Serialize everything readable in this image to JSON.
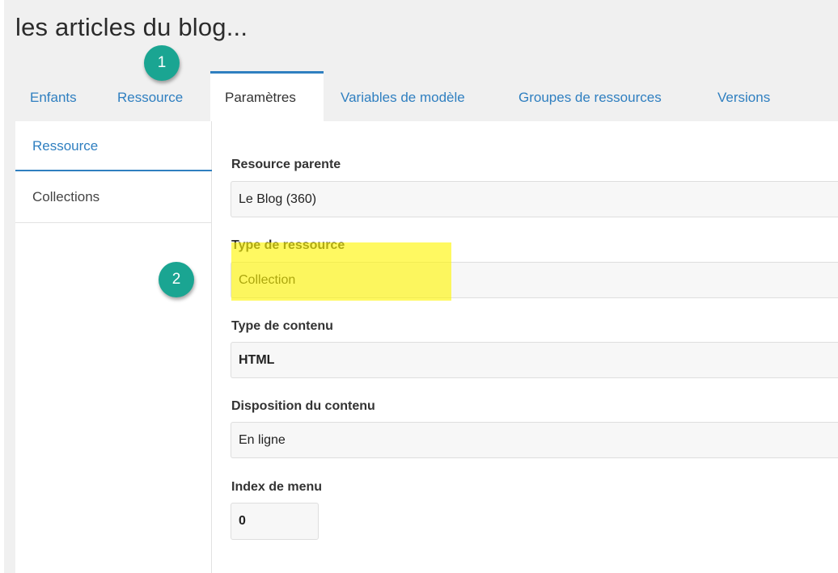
{
  "header": {
    "title": "les articles du blog..."
  },
  "tabs": [
    {
      "label": "Enfants",
      "active": false
    },
    {
      "label": "Ressource",
      "active": false
    },
    {
      "label": "Paramètres",
      "active": true
    },
    {
      "label": "Variables de modèle",
      "active": false
    },
    {
      "label": "Groupes de ressources",
      "active": false
    },
    {
      "label": "Versions",
      "active": false
    }
  ],
  "sidebar": {
    "items": [
      {
        "label": "Ressource",
        "active": true
      },
      {
        "label": "Collections",
        "active": false
      }
    ]
  },
  "form": {
    "parent": {
      "label": "Resource parente",
      "value": "Le Blog (360)"
    },
    "resource_type": {
      "label": "Type de ressource",
      "value": "Collection"
    },
    "content_type": {
      "label": "Type de contenu",
      "value": "HTML"
    },
    "content_disposition": {
      "label": "Disposition du contenu",
      "value": "En ligne"
    },
    "menu_index": {
      "label": "Index de menu",
      "value": "0"
    }
  },
  "annotations": {
    "callout_1": "1",
    "callout_2": "2",
    "callout_color": "#1aa592",
    "highlight_color": "#fff600"
  },
  "colors": {
    "accent": "#2f7fc0",
    "header_bg": "#f0f0f0"
  }
}
